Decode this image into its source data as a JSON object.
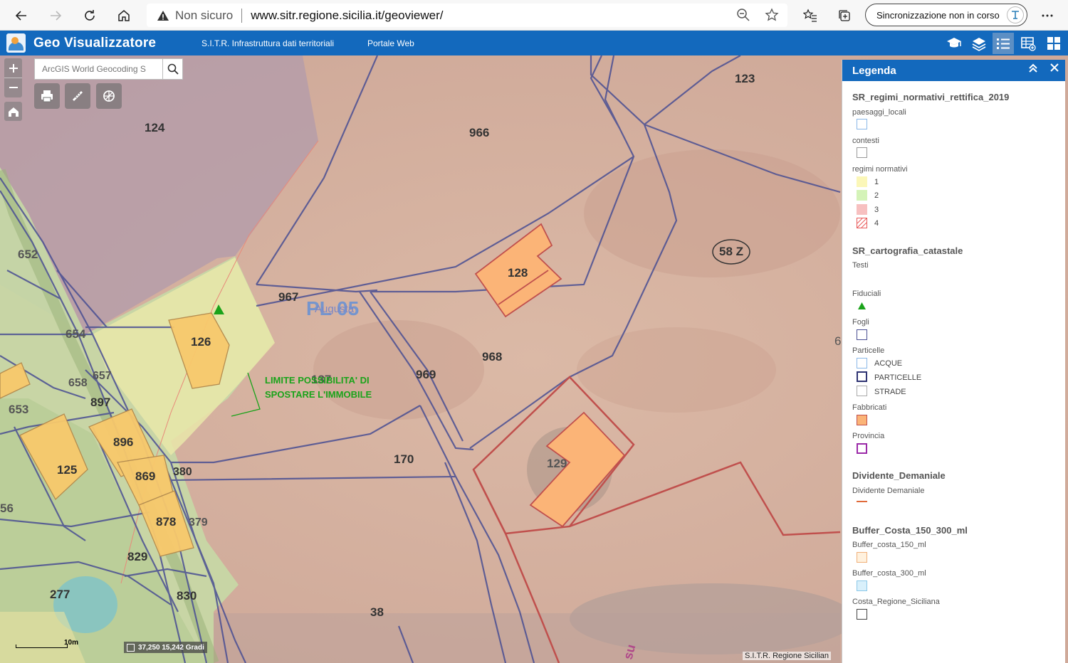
{
  "browser": {
    "security": "Non sicuro",
    "url": "www.sitr.regione.sicilia.it/geoviewer/",
    "sync_label": "Sincronizzazione non in corso"
  },
  "header": {
    "title": "Geo Visualizzatore",
    "links": [
      "S.I.T.R. Infrastruttura dati territoriali",
      "Portale Web"
    ]
  },
  "map": {
    "search_placeholder": "ArcGIS World Geocoding S",
    "parcels": [
      "124",
      "966",
      "123",
      "652",
      "967",
      "128",
      "58 Z",
      "654",
      "126",
      "657",
      "658",
      "897",
      "653",
      "969",
      "968",
      "896",
      "125",
      "170",
      "869",
      "380",
      "129",
      "56",
      "878",
      "379",
      "829",
      "277",
      "830",
      "38"
    ],
    "sheet_label": "PL 05",
    "place_label": "Augusta",
    "parcel_137": "137",
    "annotation_line1": "LIMITE POSSIBILITA'  DI",
    "annotation_line2": "SPOSTARE L'IMMOBILE",
    "scale_label": "10m",
    "coordinates": "37,250 15,242 Gradi",
    "attribution": "S.I.T.R. Regione Sicilian",
    "edge_char": "6",
    "road_char": "su"
  },
  "legend": {
    "title": "Legenda",
    "layers": [
      {
        "name": "SR_regimi_normativi_rettifica_2019"
      },
      {
        "name": "SR_cartografia_catastale"
      },
      {
        "name": "Dividente_Demaniale"
      },
      {
        "name": "Buffer_Costa_150_300_ml"
      }
    ],
    "sub": {
      "paesaggi_locali": "paesaggi_locali",
      "contesti": "contesti",
      "regimi_normativi": "regimi normativi",
      "regimi_values": [
        "1",
        "2",
        "3",
        "4"
      ],
      "testi": "Testi",
      "fiduciali": "Fiduciali",
      "fogli": "Fogli",
      "particelle": "Particelle",
      "particelle_items": [
        "ACQUE",
        "PARTICELLE",
        "STRADE"
      ],
      "fabbricati": "Fabbricati",
      "provincia": "Provincia",
      "dividente": "Dividente Demaniale",
      "buffer150": "Buffer_costa_150_ml",
      "buffer300": "Buffer_costa_300_ml",
      "costa": "Costa_Regione_Siciliana"
    }
  },
  "colors": {
    "header_blue": "#1369bd",
    "parcel_line": "#4a4f93",
    "building_fill": "#fbb477",
    "regime_1": "#fbf7b8",
    "regime_2": "#d4f3b8",
    "regime_3": "#f7c0c0",
    "annotation_green": "#1aa31a"
  },
  "icons": [
    "back-icon",
    "forward-icon",
    "refresh-icon",
    "home-icon",
    "warning-icon",
    "zoom-icon",
    "star-icon",
    "favorites-icon",
    "collections-icon",
    "more-icon",
    "print-icon",
    "measure-icon",
    "draw-icon",
    "search-icon",
    "layers-icon",
    "legend-icon",
    "grid-icon"
  ]
}
